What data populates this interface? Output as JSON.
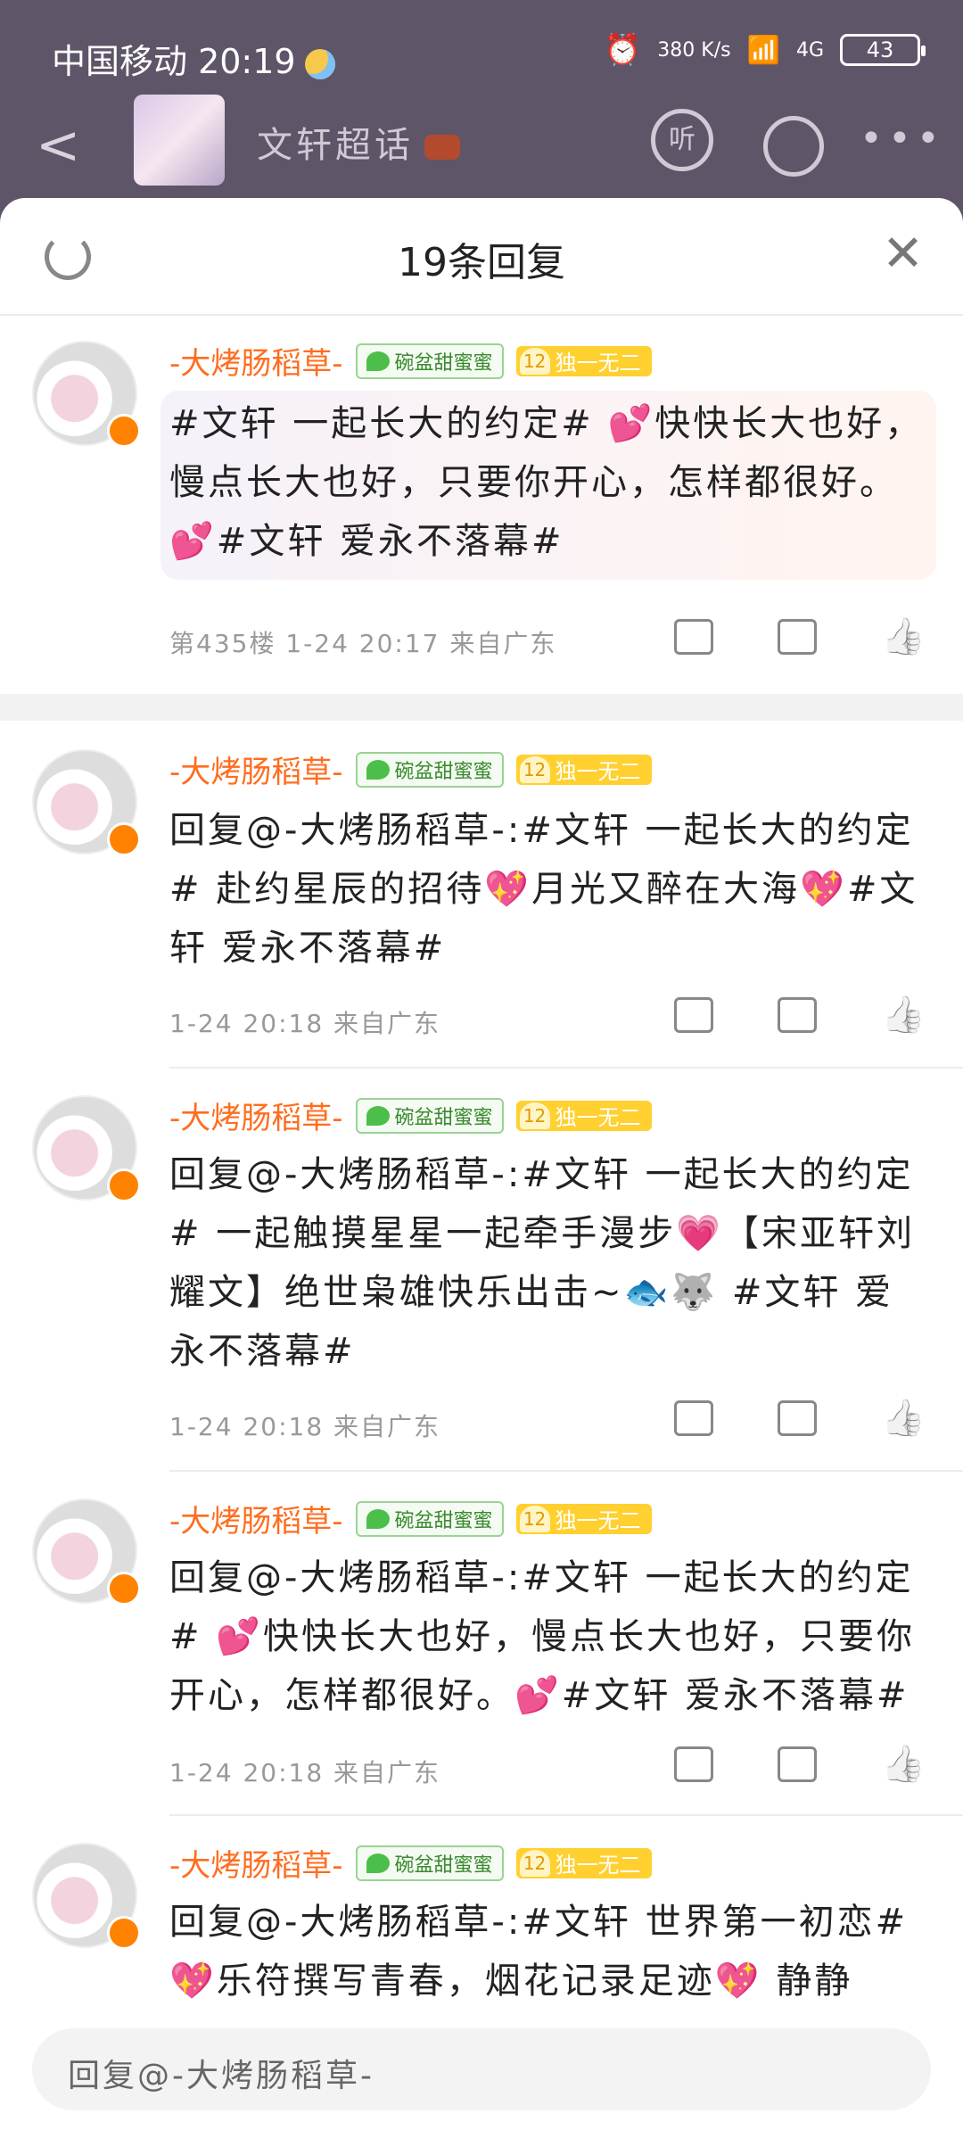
{
  "status_bar": {
    "carrier_time": "中国移动 20:19",
    "net_speed": "380 K/s",
    "network": "4G",
    "battery": "43"
  },
  "header": {
    "title": "文轩超话",
    "listen_label": "听"
  },
  "sheet": {
    "title": "19条回复"
  },
  "comments": [
    {
      "username": "-大烤肠稻草-",
      "fan_badge": "碗盆甜蜜蜜",
      "level": "12",
      "level_label": "独一无二",
      "text": "#文轩 一起长大的约定# 💕快快长大也好，慢点长大也好，只要你开心，怎样都很好。💕#文轩 爱永不落幕#",
      "meta": "第435楼 1-24 20:17 来自广东"
    },
    {
      "username": "-大烤肠稻草-",
      "fan_badge": "碗盆甜蜜蜜",
      "level": "12",
      "level_label": "独一无二",
      "text": "回复@-大烤肠稻草-:#文轩 一起长大的约定# 赴约星辰的招待💖月光又醉在大海💖#文轩 爱永不落幕#",
      "meta": "1-24 20:18 来自广东"
    },
    {
      "username": "-大烤肠稻草-",
      "fan_badge": "碗盆甜蜜蜜",
      "level": "12",
      "level_label": "独一无二",
      "text": "回复@-大烤肠稻草-:#文轩 一起长大的约定# 一起触摸星星一起牵手漫步💗【宋亚轩刘耀文】绝世枭雄快乐出击~🐟🐺 #文轩 爱永不落幕#",
      "meta": "1-24 20:18 来自广东"
    },
    {
      "username": "-大烤肠稻草-",
      "fan_badge": "碗盆甜蜜蜜",
      "level": "12",
      "level_label": "独一无二",
      "text": "回复@-大烤肠稻草-:#文轩 一起长大的约定# 💕快快长大也好，慢点长大也好，只要你开心，怎样都很好。💕#文轩 爱永不落幕#",
      "meta": "1-24 20:18 来自广东"
    },
    {
      "username": "-大烤肠稻草-",
      "fan_badge": "碗盆甜蜜蜜",
      "level": "12",
      "level_label": "独一无二",
      "text": "回复@-大烤肠稻草-:#文轩 世界第一初恋# 💖乐符撰写青春，烟花记录足迹💖 静静",
      "meta": ""
    }
  ],
  "reply_input": {
    "placeholder": "回复@-大烤肠稻草-"
  }
}
